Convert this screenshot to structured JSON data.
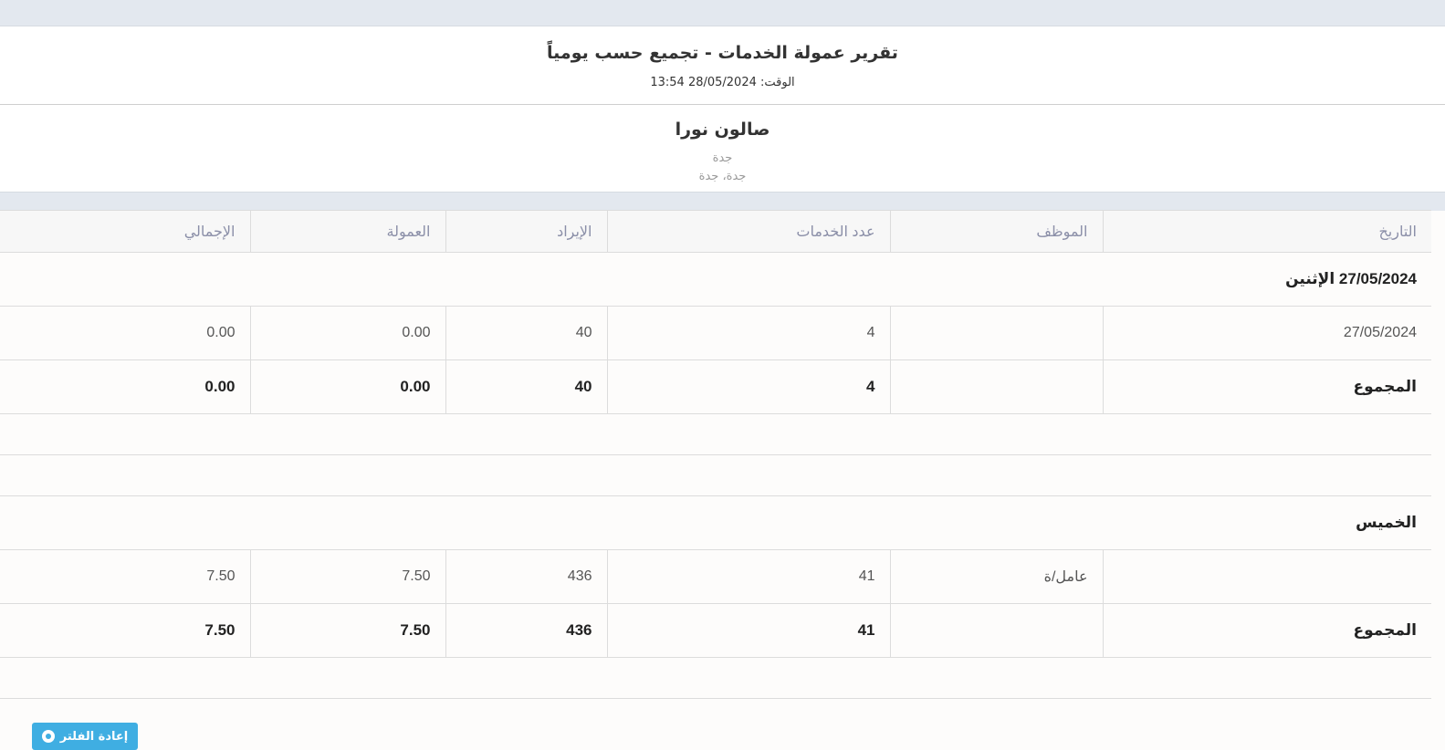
{
  "report": {
    "title": "تقرير عمولة الخدمات - تجميع حسب يومياً",
    "time_label": "الوقت: 28/05/2024 13:54"
  },
  "company": {
    "name": "صالون نورا",
    "city": "جدة",
    "address": "جدة، جدة"
  },
  "table": {
    "headers": {
      "date": "التاريخ",
      "employee": "الموظف",
      "services_count": "عدد الخدمات",
      "revenue": "الإيراد",
      "commission": "العمولة",
      "total": "الإجمالي"
    },
    "groups": [
      {
        "title": "27/05/2024 الإثنين",
        "row": {
          "date": "27/05/2024",
          "employee": "",
          "services_count": "4",
          "revenue": "40",
          "commission": "0.00",
          "total": "0.00"
        },
        "totals": {
          "label": "المجموع",
          "services_count": "4",
          "revenue": "40",
          "commission": "0.00",
          "total": "0.00"
        }
      },
      {
        "title": "الخميس",
        "row": {
          "date": "",
          "employee": "عامل/ة",
          "services_count": "41",
          "revenue": "436",
          "commission": "7.50",
          "total": "7.50"
        },
        "totals": {
          "label": "المجموع",
          "services_count": "41",
          "revenue": "436",
          "commission": "7.50",
          "total": "7.50"
        }
      }
    ]
  },
  "action_button": {
    "label": "إعادة الفلتر",
    "icon": "circle-icon"
  },
  "colors": {
    "band": "#e3e8ef",
    "header_text": "#8b8fa8",
    "button": "#3faee2"
  }
}
